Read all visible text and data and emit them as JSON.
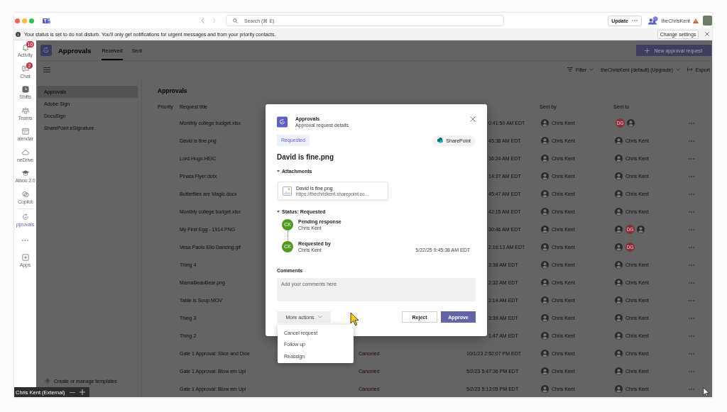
{
  "title_bar": {
    "search": {
      "placeholder": "Search (⌘ E)"
    },
    "update_button": "Update",
    "account_name": "theChrisKent"
  },
  "notice_bar": {
    "message": "Your status is set to do not disturb. You'll only get notifications for urgent messages and from your priority contacts.",
    "button": "Change settings"
  },
  "app_rail": {
    "items": [
      {
        "label": "Activity",
        "badge": "10",
        "selected": false
      },
      {
        "label": "Chat",
        "badge": "2",
        "selected": false
      },
      {
        "label": "Shifts",
        "selected": false
      },
      {
        "label": "Teams",
        "selected": false
      },
      {
        "label": "alendar",
        "selected": false
      },
      {
        "label": "neDrive",
        "selected": false
      },
      {
        "label": "Aibou 2.0",
        "selected": false
      },
      {
        "label": "Copilot",
        "selected": false
      },
      {
        "label": "pprovals",
        "selected": true
      }
    ],
    "apps_label": "Apps"
  },
  "header": {
    "app_name": "Approvals",
    "tabs": [
      {
        "label": "Received",
        "selected": true
      },
      {
        "label": "Sent",
        "selected": false
      }
    ],
    "new_button": "New approval request"
  },
  "toolbar": {
    "filter": "Filter",
    "workspace": "theChrisKent (default) (Upgrade)",
    "export": "Export"
  },
  "sidebar": {
    "items": [
      {
        "label": "Approvals",
        "selected": true
      },
      {
        "label": "Adobe Sign",
        "selected": false
      },
      {
        "label": "DocuSign",
        "selected": false
      },
      {
        "label": "SharePoint eSignature",
        "selected": false
      }
    ],
    "footer_link": "Create or manage templates"
  },
  "table": {
    "heading": "Approvals",
    "column_headers": {
      "priority": "Priority",
      "request_title": "Request title",
      "sent_by": "Sent by",
      "sent_to": "Sent to"
    },
    "rows": [
      {
        "title": "Monthly college budget.xlsx",
        "date": "0:41:50 AM EDT",
        "sent_by": "Chris Kent",
        "sent_to": {
          "avatars": [
            {
              "kind": "initials",
              "initials": "DG"
            },
            {
              "kind": "photo"
            }
          ]
        }
      },
      {
        "title": "David is fine.png",
        "date": "45:38 AM EDT",
        "sent_by": "Chris Kent",
        "sent_to": {
          "avatars": [
            {
              "kind": "photo"
            }
          ],
          "name": "Chris Kent"
        }
      },
      {
        "title": "Lord Hugo.HEIC",
        "date": "36:24 AM EDT",
        "sent_by": "Chris Kent",
        "sent_to": {
          "avatars": [
            {
              "kind": "photo"
            }
          ],
          "name": "Chris Kent"
        }
      },
      {
        "title": "Pinata Flyer.dotx",
        "date": "14:37 AM EDT",
        "sent_by": "Chris Kent",
        "sent_to": {
          "avatars": [
            {
              "kind": "photo"
            }
          ],
          "name": "Chris Kent"
        }
      },
      {
        "title": "Butterflies are Magic.docx",
        "date": "45:47 AM EDT",
        "sent_by": "Chris Kent",
        "sent_to": {
          "avatars": [
            {
              "kind": "photo"
            }
          ],
          "name": "Chris Kent"
        }
      },
      {
        "title": "Monthly college budget.xlsx",
        "date": "42:15 AM EDT",
        "sent_by": "Chris Kent",
        "sent_to": {
          "avatars": [
            {
              "kind": "photo"
            }
          ],
          "name": "Chris Kent"
        }
      },
      {
        "title": "My First Egg - 1914.PNG",
        "date": "30:46 AM EDT",
        "sent_by": "Chris Kent",
        "sent_to": {
          "avatars": [
            {
              "kind": "photo"
            },
            {
              "kind": "initials",
              "initials": "DG"
            },
            {
              "kind": "photo"
            }
          ]
        }
      },
      {
        "title": "Vesa Paolo Elio Dancing.gif",
        "date": "2:16:13 AM EDT",
        "sent_by": "Chris Kent",
        "sent_to": {
          "avatars": [
            {
              "kind": "photo"
            },
            {
              "kind": "initials",
              "initials": "DG"
            }
          ]
        }
      },
      {
        "title": "Thing 4",
        "date": "3:38 AM EDT",
        "sent_by": "Chris Kent",
        "sent_to": {
          "avatars": [
            {
              "kind": "photo"
            }
          ],
          "name": "Chris Kent"
        }
      },
      {
        "title": "MamaBeauBear.png",
        "date": "2:32 AM EDT",
        "sent_by": "Chris Kent",
        "sent_to": {
          "avatars": [
            {
              "kind": "photo"
            }
          ],
          "name": "Chris Kent"
        }
      },
      {
        "title": "Table is Soup.MOV",
        "date": "2:14 AM EDT",
        "sent_by": "Chris Kent",
        "sent_to": {
          "avatars": [
            {
              "kind": "photo"
            }
          ],
          "name": "Chris Kent"
        }
      },
      {
        "title": "Thing 3",
        "date": "3:39 AM EDT",
        "sent_by": "Chris Kent",
        "sent_to": {
          "avatars": [
            {
              "kind": "photo"
            }
          ],
          "name": "Chris Kent"
        }
      },
      {
        "title": "Thing 2",
        "date": "1:47 AM EDT",
        "sent_by": "Chris Kent",
        "sent_to": {
          "avatars": [
            {
              "kind": "photo"
            }
          ],
          "name": "Chris Kent"
        }
      },
      {
        "title": "Gate 1 Approval: Slice and Dice",
        "status": "Canceled",
        "date": "10/1/23 2:52:07 PM EDT",
        "sent_by": "Chris Kent",
        "sent_to": {
          "avatars": [
            {
              "kind": "photo"
            }
          ],
          "name": "Chris Kent"
        }
      },
      {
        "title": "Gate 1 Approval: Blow em Up!",
        "status": "Canceled",
        "date": "5/2/23 5:47:36 PM EDT",
        "sent_by": "Chris Kent",
        "sent_to": {
          "avatars": [
            {
              "kind": "photo"
            }
          ],
          "name": "Chris Kent"
        }
      },
      {
        "title": "Gate 1 Approval: Blow em Up!",
        "status": "Canceled",
        "date": "5/2/23 5:13:05 PM EDT",
        "sent_by": "Chris Kent",
        "sent_to": {
          "avatars": [
            {
              "kind": "photo"
            }
          ],
          "name": "Chris Kent"
        }
      }
    ]
  },
  "dialog": {
    "app_name": "Approvals",
    "subtitle": "Approval request details",
    "status_badge": "Requested",
    "source": "SharePoint",
    "title": "David is fine.png",
    "attachments_label": "Attachments",
    "attachment": {
      "name": "David is fine.png",
      "url": "https://thechriskent.sharepoint.co…"
    },
    "status_label": "Status: Requested",
    "timeline": [
      {
        "initials": "CK",
        "caption": "Pending response",
        "name": "Chris Kent"
      },
      {
        "initials": "CK",
        "caption": "Requested by",
        "name": "Chris Kent",
        "time": "5/22/25 9:45:38 AM EDT"
      }
    ],
    "comments_label": "Comments",
    "comments": {
      "placeholder": "Add your comments here"
    },
    "more_actions": "More actions",
    "reject": "Reject",
    "approve": "Approve"
  },
  "actions_menu": {
    "items": [
      "Cancel request",
      "Follow up",
      "Reassign"
    ]
  },
  "presenter_tag": {
    "name": "Chris Kent (External)"
  }
}
